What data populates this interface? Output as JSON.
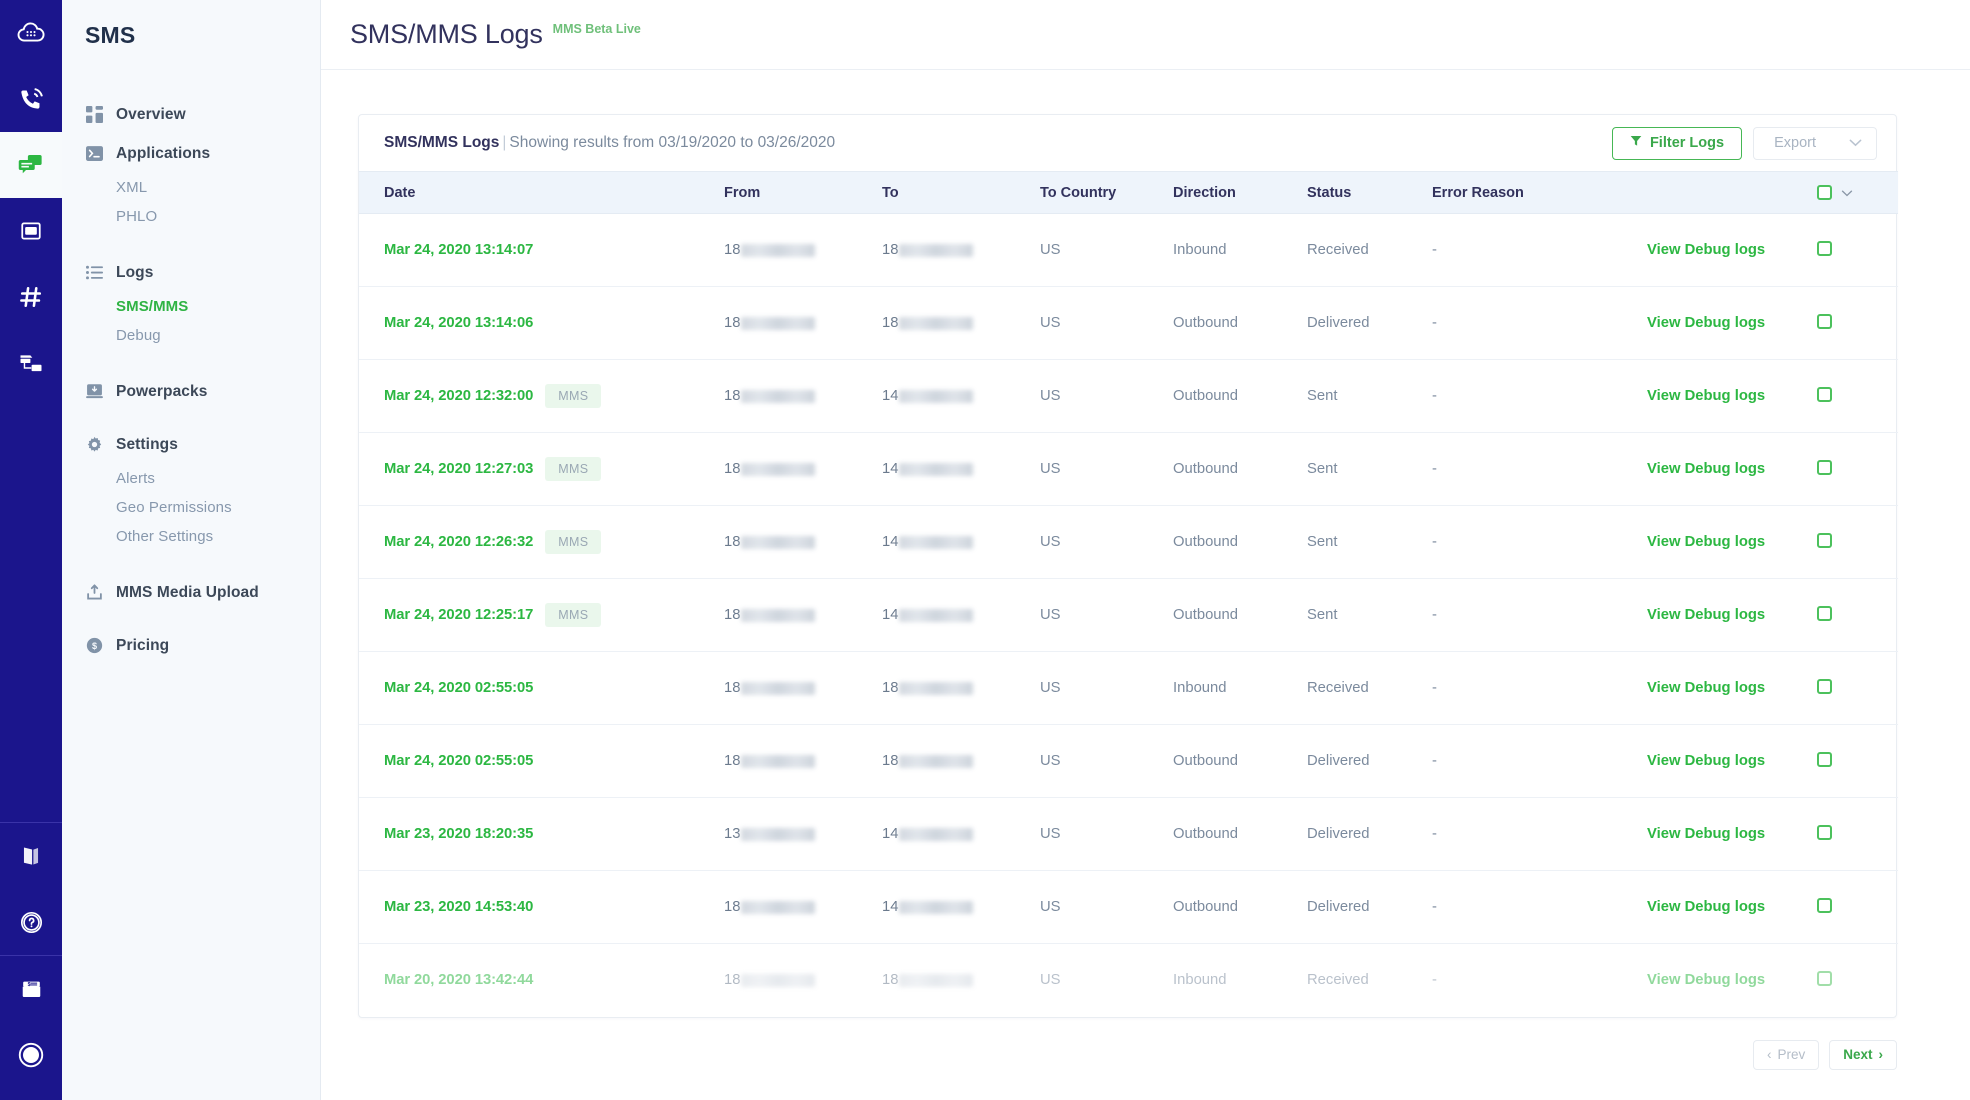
{
  "colors": {
    "rail_bg": "#1b158c",
    "sidebar_bg": "#f6f9fc",
    "accent_green": "#2cb742",
    "title_navy": "#32325d",
    "table_header_bg": "#eef4fb"
  },
  "rail": {
    "items": [
      {
        "name": "cloud-keypad-icon",
        "label": "Cloud",
        "active": false
      },
      {
        "name": "phone-voice-icon",
        "label": "Voice",
        "active": false
      },
      {
        "name": "messaging-icon",
        "label": "Messaging",
        "active": true
      },
      {
        "name": "sip-icon",
        "label": "SIP",
        "active": false
      },
      {
        "name": "hash-number-icon",
        "label": "Numbers",
        "active": false
      },
      {
        "name": "phlo-flow-icon",
        "label": "PHLO",
        "active": false
      }
    ],
    "bottom_items": [
      {
        "name": "docs-book-icon",
        "label": "Docs"
      },
      {
        "name": "help-question-icon",
        "label": "Help"
      },
      {
        "name": "billing-envelope-icon",
        "label": "Billing"
      },
      {
        "name": "account-circle-icon",
        "label": "Account"
      }
    ]
  },
  "sidebar": {
    "brand": "SMS",
    "items": [
      {
        "label": "Overview",
        "icon": "grid-dashboard-icon",
        "type": "item",
        "active": false
      },
      {
        "label": "Applications",
        "icon": "terminal-icon",
        "type": "item",
        "active": false
      },
      {
        "label": "XML",
        "type": "sub",
        "active": false
      },
      {
        "label": "PHLO",
        "type": "sub",
        "active": false
      },
      {
        "label": "Logs",
        "icon": "list-icon",
        "type": "item",
        "active": false
      },
      {
        "label": "SMS/MMS",
        "type": "sub",
        "active": true
      },
      {
        "label": "Debug",
        "type": "sub",
        "active": false
      },
      {
        "label": "Powerpacks",
        "icon": "powerpack-icon",
        "type": "item",
        "active": false
      },
      {
        "label": "Settings",
        "icon": "gear-icon",
        "type": "item",
        "active": false
      },
      {
        "label": "Alerts",
        "type": "sub",
        "active": false
      },
      {
        "label": "Geo Permissions",
        "type": "sub",
        "active": false
      },
      {
        "label": "Other Settings",
        "type": "sub",
        "active": false
      },
      {
        "label": "MMS Media Upload",
        "icon": "upload-icon",
        "type": "item",
        "active": false
      },
      {
        "label": "Pricing",
        "icon": "dollar-circle-icon",
        "type": "item",
        "active": false
      }
    ]
  },
  "header": {
    "title": "SMS/MMS Logs",
    "beta_tag": "MMS Beta Live"
  },
  "card": {
    "title_main": "SMS/MMS Logs",
    "title_sep": "|",
    "title_sub": "Showing results from 03/19/2020 to 03/26/2020",
    "filter_button": "Filter Logs",
    "export_button": "Export",
    "export_chevron": "⌄"
  },
  "table": {
    "columns": [
      "Date",
      "From",
      "To",
      "To Country",
      "Direction",
      "Status",
      "Error Reason"
    ],
    "debug_link_label": "View Debug logs",
    "rows": [
      {
        "date": "Mar 24, 2020 13:14:07",
        "badge": "",
        "from_prefix": "18",
        "from_mask_w": 74,
        "to_prefix": "18",
        "to_mask_w": 74,
        "country": "US",
        "direction": "Inbound",
        "status": "Received",
        "error": "-",
        "faded": false
      },
      {
        "date": "Mar 24, 2020 13:14:06",
        "badge": "",
        "from_prefix": "18",
        "from_mask_w": 74,
        "to_prefix": "18",
        "to_mask_w": 74,
        "country": "US",
        "direction": "Outbound",
        "status": "Delivered",
        "error": "-",
        "faded": false
      },
      {
        "date": "Mar 24, 2020 12:32:00",
        "badge": "MMS",
        "from_prefix": "18",
        "from_mask_w": 74,
        "to_prefix": "14",
        "to_mask_w": 74,
        "country": "US",
        "direction": "Outbound",
        "status": "Sent",
        "error": "-",
        "faded": false
      },
      {
        "date": "Mar 24, 2020 12:27:03",
        "badge": "MMS",
        "from_prefix": "18",
        "from_mask_w": 74,
        "to_prefix": "14",
        "to_mask_w": 74,
        "country": "US",
        "direction": "Outbound",
        "status": "Sent",
        "error": "-",
        "faded": false
      },
      {
        "date": "Mar 24, 2020 12:26:32",
        "badge": "MMS",
        "from_prefix": "18",
        "from_mask_w": 74,
        "to_prefix": "14",
        "to_mask_w": 74,
        "country": "US",
        "direction": "Outbound",
        "status": "Sent",
        "error": "-",
        "faded": false
      },
      {
        "date": "Mar 24, 2020 12:25:17",
        "badge": "MMS",
        "from_prefix": "18",
        "from_mask_w": 74,
        "to_prefix": "14",
        "to_mask_w": 74,
        "country": "US",
        "direction": "Outbound",
        "status": "Sent",
        "error": "-",
        "faded": false
      },
      {
        "date": "Mar 24, 2020 02:55:05",
        "badge": "",
        "from_prefix": "18",
        "from_mask_w": 74,
        "to_prefix": "18",
        "to_mask_w": 74,
        "country": "US",
        "direction": "Inbound",
        "status": "Received",
        "error": "-",
        "faded": false
      },
      {
        "date": "Mar 24, 2020 02:55:05",
        "badge": "",
        "from_prefix": "18",
        "from_mask_w": 74,
        "to_prefix": "18",
        "to_mask_w": 74,
        "country": "US",
        "direction": "Outbound",
        "status": "Delivered",
        "error": "-",
        "faded": false
      },
      {
        "date": "Mar 23, 2020 18:20:35",
        "badge": "",
        "from_prefix": "13",
        "from_mask_w": 74,
        "to_prefix": "14",
        "to_mask_w": 74,
        "country": "US",
        "direction": "Outbound",
        "status": "Delivered",
        "error": "-",
        "faded": false
      },
      {
        "date": "Mar 23, 2020 14:53:40",
        "badge": "",
        "from_prefix": "18",
        "from_mask_w": 74,
        "to_prefix": "14",
        "to_mask_w": 74,
        "country": "US",
        "direction": "Outbound",
        "status": "Delivered",
        "error": "-",
        "faded": false
      },
      {
        "date": "Mar 20, 2020 13:42:44",
        "badge": "",
        "from_prefix": "18",
        "from_mask_w": 74,
        "to_prefix": "18",
        "to_mask_w": 74,
        "country": "US",
        "direction": "Inbound",
        "status": "Received",
        "error": "-",
        "faded": true
      }
    ]
  },
  "pagination": {
    "prev": "Prev",
    "next": "Next",
    "prev_chevron": "‹",
    "next_chevron": "›"
  }
}
